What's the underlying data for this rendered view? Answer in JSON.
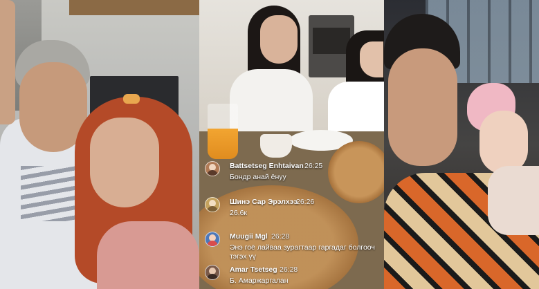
{
  "comments": [
    {
      "name": "Battsetseg Enhtaivan",
      "time": "26:25",
      "text": "Бондр анай ёнуу",
      "avatar_color": "#b07a55"
    },
    {
      "name": "Шинэ Сар Эрэлхээ",
      "time": "26:26",
      "text": "26.6к",
      "avatar_color": "#c4a25d"
    },
    {
      "name": "Muugii Mgl",
      "time": "26:28",
      "text": "Энэ гоё лайваа зурагтаар гаргадаг болгооч тэгэх үү",
      "avatar_color": "#4d78b8"
    },
    {
      "name": "Amar Tsetseg",
      "time": "26:28",
      "text": "Б. Амаржаргалан",
      "avatar_color": "#7a5a4a"
    }
  ],
  "colors": {
    "sweater_orange": "#d9672a",
    "sweater_black": "#1a1a1a",
    "hair_red": "#b44a28",
    "pizza": "#c8955a"
  }
}
